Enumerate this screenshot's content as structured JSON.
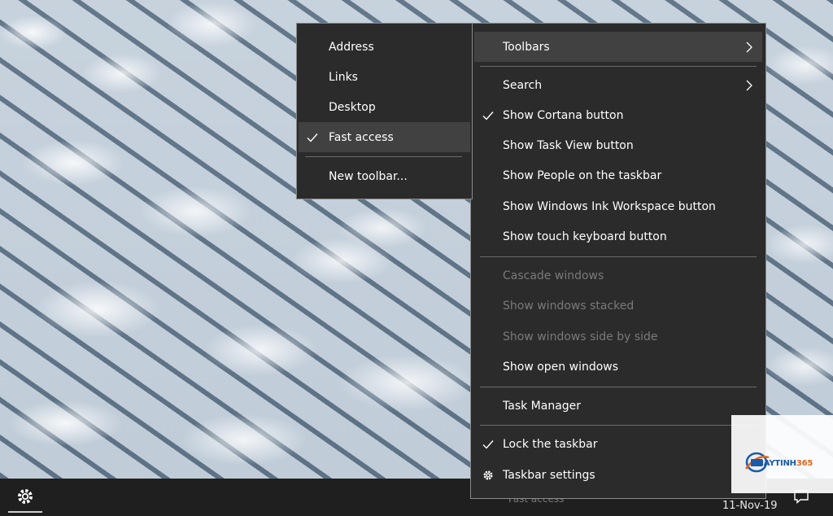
{
  "submenu": {
    "items": [
      {
        "label": "Address",
        "checked": false
      },
      {
        "label": "Links",
        "checked": false
      },
      {
        "label": "Desktop",
        "checked": false
      },
      {
        "label": "Fast access",
        "checked": true
      },
      {
        "label": "New toolbar...",
        "checked": false
      }
    ]
  },
  "mainmenu": {
    "items": [
      {
        "label": "Toolbars",
        "submenu": true,
        "highlighted": true
      },
      {
        "label": "Search",
        "submenu": true
      },
      {
        "label": "Show Cortana button",
        "checked": true
      },
      {
        "label": "Show Task View button"
      },
      {
        "label": "Show People on the taskbar"
      },
      {
        "label": "Show Windows Ink Workspace button"
      },
      {
        "label": "Show touch keyboard button"
      },
      {
        "label": "Cascade windows",
        "disabled": true
      },
      {
        "label": "Show windows stacked",
        "disabled": true
      },
      {
        "label": "Show windows side by side",
        "disabled": true
      },
      {
        "label": "Show open windows"
      },
      {
        "label": "Task Manager"
      },
      {
        "label": "Lock the taskbar",
        "checked": true
      },
      {
        "label": "Taskbar settings",
        "icon": "gear-icon"
      }
    ]
  },
  "taskbar": {
    "clock": "11-Nov-19",
    "tray_text": "Fast access"
  },
  "watermark": {
    "brand_main": "MAYTINH",
    "brand_accent": "365"
  },
  "colors": {
    "menu_bg": "#2b2b2b",
    "highlight": "#414141",
    "disabled_text": "#7a7a7a",
    "taskbar_bg": "#1f1f1f",
    "logo_blue": "#1a5aa8",
    "logo_orange": "#e0661e"
  }
}
